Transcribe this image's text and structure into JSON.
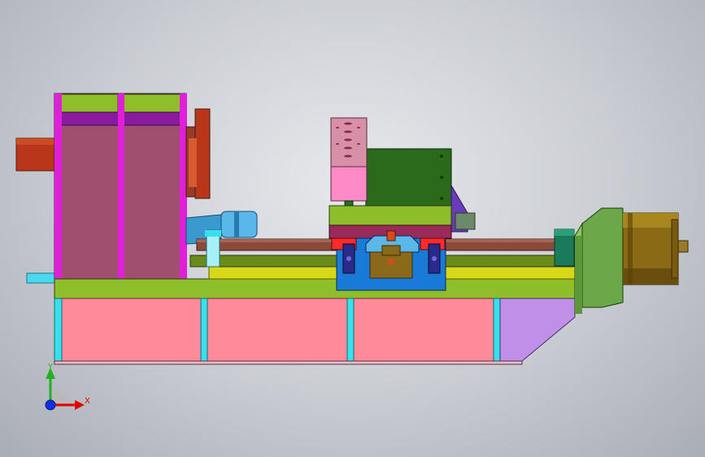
{
  "viewport": {
    "axes": {
      "x_label": "X",
      "y_label": "Y"
    },
    "colors": {
      "background_top": "#e6e8ec",
      "background_bottom": "#a9adb5",
      "axis_x": "#e00000",
      "axis_y": "#20b020",
      "axis_z": "#1030e0"
    }
  }
}
